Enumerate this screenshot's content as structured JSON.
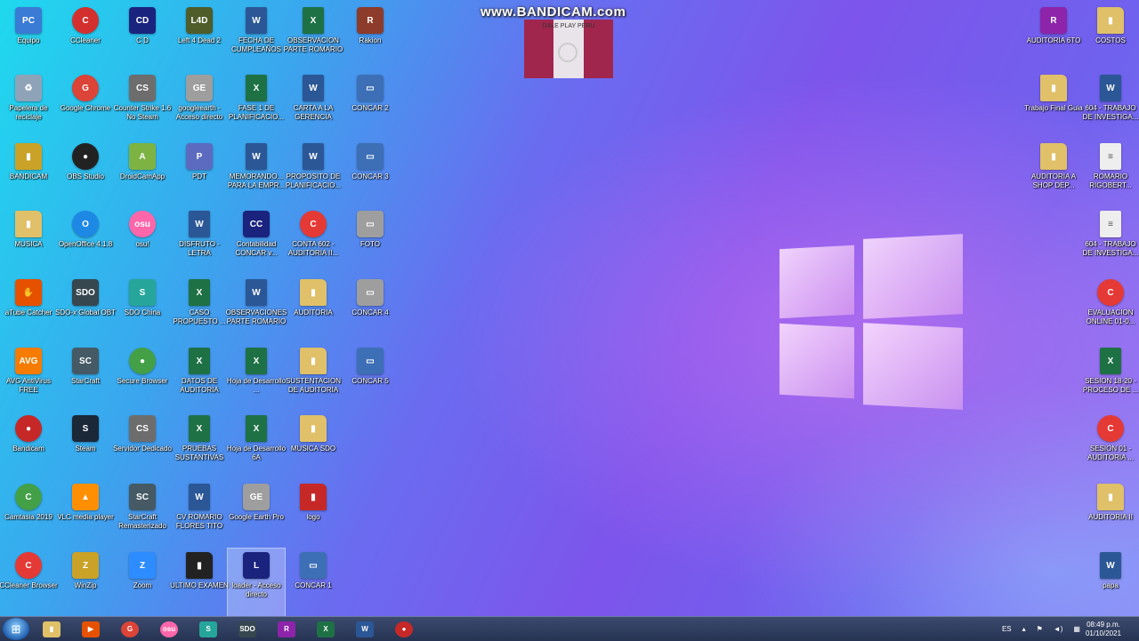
{
  "watermark": "www.BANDICAM.com",
  "overlay": {
    "title": "DALE PLAY PERU"
  },
  "icons": [
    {
      "label": "Equipo",
      "glyph": "PC",
      "color": "#3a7bd5"
    },
    {
      "label": "CCleaner",
      "glyph": "C",
      "color": "#d32f2f"
    },
    {
      "label": "C D",
      "glyph": "CD",
      "color": "#1a237e"
    },
    {
      "label": "Left 4 Dead 2",
      "glyph": "L4D",
      "color": "#4e5d2a"
    },
    {
      "label": "FECHA DE CUMPLEAÑOS",
      "glyph": "W",
      "color": "#2b5797"
    },
    {
      "label": "OBSERVACION PARTE ROMARIO",
      "glyph": "X",
      "color": "#1e7145"
    },
    {
      "label": "Rakion",
      "glyph": "R",
      "color": "#8d3b2a"
    },
    {
      "label": "Papelera de reciclaje",
      "glyph": "♻",
      "color": "#8fa3b8"
    },
    {
      "label": "Google Chrome",
      "glyph": "G",
      "color": "#db4437"
    },
    {
      "label": "Counter Strike 1.6 No Steam",
      "glyph": "CS",
      "color": "#6d6d6d"
    },
    {
      "label": "googleearth - Acceso directo",
      "glyph": "GE",
      "color": "#9e9e9e"
    },
    {
      "label": "FASE 1 DE PLANIFICACIO...",
      "glyph": "X",
      "color": "#1e7145"
    },
    {
      "label": "CARTA A LA GERENCIA",
      "glyph": "W",
      "color": "#2b5797"
    },
    {
      "label": "CONCAR 2",
      "glyph": "▭",
      "color": "#3d6fb6"
    },
    {
      "label": "BANDICAM",
      "glyph": "▮",
      "color": "#c9a227"
    },
    {
      "label": "OBS Studio",
      "glyph": "●",
      "color": "#222222"
    },
    {
      "label": "DroidCamApp",
      "glyph": "A",
      "color": "#7cb342"
    },
    {
      "label": "PDT",
      "glyph": "P",
      "color": "#5c6bc0"
    },
    {
      "label": "MEMORANDO... PARA LA EMPR...",
      "glyph": "W",
      "color": "#2b5797"
    },
    {
      "label": "PROPOSITO DE PLANIFICACIO...",
      "glyph": "W",
      "color": "#2b5797"
    },
    {
      "label": "CONCAR 3",
      "glyph": "▭",
      "color": "#3d6fb6"
    },
    {
      "label": "MUSICA",
      "glyph": "▮",
      "color": "#e0c068"
    },
    {
      "label": "OpenOffice 4.1.8",
      "glyph": "O",
      "color": "#1e88e5"
    },
    {
      "label": "osu!",
      "glyph": "osu",
      "color": "#ff66aa"
    },
    {
      "label": "DISFRUTO - LETRA",
      "glyph": "W",
      "color": "#2b5797"
    },
    {
      "label": "Contabilidad CONCAR v...",
      "glyph": "CC",
      "color": "#1a237e"
    },
    {
      "label": "CONTA 602 - AUDITORIA II...",
      "glyph": "C",
      "color": "#e53935"
    },
    {
      "label": "FOTO",
      "glyph": "▭",
      "color": "#9e9e9e"
    },
    {
      "label": "aTube Catcher",
      "glyph": "✋",
      "color": "#e65100"
    },
    {
      "label": "SDO-x Global OBT",
      "glyph": "SDO",
      "color": "#37474f"
    },
    {
      "label": "SDO China",
      "glyph": "S",
      "color": "#26a69a"
    },
    {
      "label": "CASO PROPUESTO ...",
      "glyph": "X",
      "color": "#1e7145"
    },
    {
      "label": "OBSERVACIONES PARTE ROMARIO",
      "glyph": "W",
      "color": "#2b5797"
    },
    {
      "label": "AUDITORIA",
      "glyph": "▮",
      "color": "#e0c068"
    },
    {
      "label": "CONCAR 4",
      "glyph": "▭",
      "color": "#9e9e9e"
    },
    {
      "label": "AVG AntiVirus FREE",
      "glyph": "AVG",
      "color": "#f57c00"
    },
    {
      "label": "StarCraft",
      "glyph": "SC",
      "color": "#455a64"
    },
    {
      "label": "Secure Browser",
      "glyph": "●",
      "color": "#43a047"
    },
    {
      "label": "DATOS DE AUDITORIA",
      "glyph": "X",
      "color": "#1e7145"
    },
    {
      "label": "Hoja de Desarrollo ...",
      "glyph": "X",
      "color": "#1e7145"
    },
    {
      "label": "SUSTENTACION DE AUDITORIA",
      "glyph": "▮",
      "color": "#e0c068"
    },
    {
      "label": "CONCAR 5",
      "glyph": "▭",
      "color": "#3d6fb6"
    },
    {
      "label": "Bandicam",
      "glyph": "●",
      "color": "#c62828"
    },
    {
      "label": "Steam",
      "glyph": "S",
      "color": "#1b2838"
    },
    {
      "label": "Servidor Dedicado",
      "glyph": "CS",
      "color": "#6d6d6d"
    },
    {
      "label": "PRUEBAS SUSTANTIVAS",
      "glyph": "X",
      "color": "#1e7145"
    },
    {
      "label": "Hoja de Desarrollo 6A",
      "glyph": "X",
      "color": "#1e7145"
    },
    {
      "label": "MUSICA SDO",
      "glyph": "▮",
      "color": "#e0c068"
    },
    {
      "label": "Camtasia 2019",
      "glyph": "C",
      "color": "#43a047"
    },
    {
      "label": "VLC media player",
      "glyph": "▲",
      "color": "#ff8f00"
    },
    {
      "label": "StarCraft Remasterizado",
      "glyph": "SC",
      "color": "#455a64"
    },
    {
      "label": "CV ROMARIO FLORES TITO",
      "glyph": "W",
      "color": "#2b5797"
    },
    {
      "label": "Google Earth Pro",
      "glyph": "GE",
      "color": "#9e9e9e"
    },
    {
      "label": "logo",
      "glyph": "▮",
      "color": "#c62828"
    },
    {
      "label": "CCleaner Browser",
      "glyph": "C",
      "color": "#e53935"
    },
    {
      "label": "WinZip",
      "glyph": "Z",
      "color": "#c9a227"
    },
    {
      "label": "Zoom",
      "glyph": "Z",
      "color": "#2d8cff"
    },
    {
      "label": "ULTIMO EXAMEN",
      "glyph": "▮",
      "color": "#222222"
    },
    {
      "label": "loader - Acceso directo",
      "glyph": "L",
      "color": "#1a237e"
    },
    {
      "label": "CONCAR 1",
      "glyph": "▭",
      "color": "#3d6fb6"
    },
    {
      "label": "AUDITORIA 6TO",
      "glyph": "R",
      "color": "#8e24aa"
    },
    {
      "label": "COSTOS",
      "glyph": "▮",
      "color": "#e0c068"
    },
    {
      "label": "Trabajo Final Guia",
      "glyph": "▮",
      "color": "#e0c068"
    },
    {
      "label": "604 - TRABAJO DE INVESTIGA...",
      "glyph": "W",
      "color": "#2b5797"
    },
    {
      "label": "AUDITORIA A SHOP DEP...",
      "glyph": "▮",
      "color": "#e0c068"
    },
    {
      "label": "ROMARIO RIGOBERT...",
      "glyph": "≡",
      "color": "#eeeeee"
    },
    {
      "label": "604 - TRABAJO DE INVESTIGA...",
      "glyph": "≡",
      "color": "#eeeeee"
    },
    {
      "label": "EVALUACION ONLINE 01-0...",
      "glyph": "C",
      "color": "#e53935"
    },
    {
      "label": "SESION 18-20 - PROCESO DE ...",
      "glyph": "X",
      "color": "#1e7145"
    },
    {
      "label": "SESION 01 - AUDITORIA ...",
      "glyph": "C",
      "color": "#e53935"
    },
    {
      "label": "AUDITORIA II",
      "glyph": "▮",
      "color": "#e0c068"
    },
    {
      "label": "papa",
      "glyph": "W",
      "color": "#2b5797"
    }
  ],
  "taskbar": {
    "apps": [
      {
        "name": "explorer",
        "glyph": "▮",
        "color": "#e0c068"
      },
      {
        "name": "media",
        "glyph": "▶",
        "color": "#e65100"
      },
      {
        "name": "chrome",
        "glyph": "G",
        "color": "#db4437"
      },
      {
        "name": "osu",
        "glyph": "osu",
        "color": "#ff66aa"
      },
      {
        "name": "sdo",
        "glyph": "S",
        "color": "#26a69a"
      },
      {
        "name": "sdox",
        "glyph": "SDO",
        "color": "#37474f"
      },
      {
        "name": "winrar",
        "glyph": "R",
        "color": "#8e24aa"
      },
      {
        "name": "excel",
        "glyph": "X",
        "color": "#1e7145"
      },
      {
        "name": "word",
        "glyph": "W",
        "color": "#2b5797"
      },
      {
        "name": "bandicam",
        "glyph": "●",
        "color": "#c62828"
      }
    ],
    "lang": "ES",
    "time": "08:49 p.m.",
    "date": "01/10/2021"
  }
}
